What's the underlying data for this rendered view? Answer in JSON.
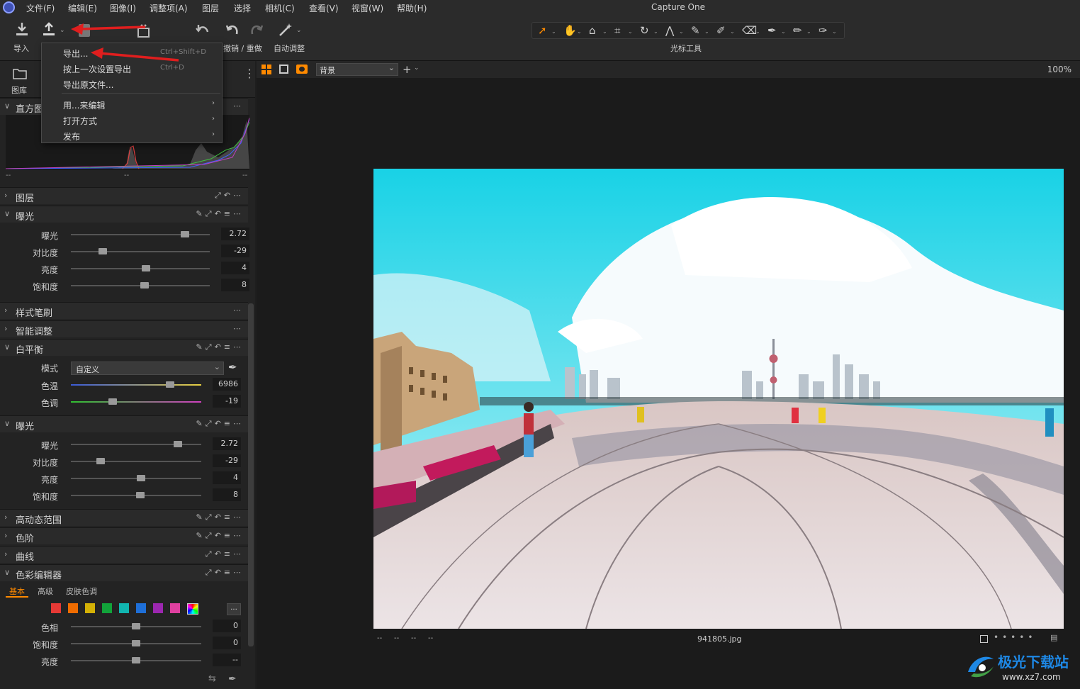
{
  "app": {
    "title": "Capture One"
  },
  "menubar": {
    "items": [
      "文件(F)",
      "编辑(E)",
      "图像(I)",
      "调整项(A)",
      "图层",
      "选择",
      "相机(C)",
      "查看(V)",
      "视窗(W)",
      "帮助(H)"
    ]
  },
  "toolbar": {
    "import_label": "导入",
    "undo_redo_label": "撤销 / 重做",
    "auto_adjust_label": "自动调整",
    "cursor_tools_label": "光标工具"
  },
  "export_menu": {
    "items": [
      {
        "label": "导出...",
        "shortcut": "Ctrl+Shift+D"
      },
      {
        "label": "按上一次设置导出",
        "shortcut": "Ctrl+D"
      },
      {
        "label": "导出原文件..."
      },
      {
        "label": "用...来编辑",
        "submenu": "›"
      },
      {
        "label": "打开方式",
        "submenu": "›"
      },
      {
        "label": "发布",
        "submenu": "›"
      }
    ]
  },
  "left_panel": {
    "tab_library": "图库",
    "histogram": {
      "title": "直方图",
      "footer": [
        "--",
        "--",
        "--"
      ]
    },
    "layers_title": "图层",
    "exposure1": {
      "title": "曝光",
      "rows": [
        {
          "label": "曝光",
          "value": "2.72",
          "level": 0.82
        },
        {
          "label": "对比度",
          "value": "-29",
          "level": 0.23
        },
        {
          "label": "亮度",
          "value": "4",
          "level": 0.54
        },
        {
          "label": "饱和度",
          "value": "8",
          "level": 0.53
        }
      ]
    },
    "style_brush_title": "样式笔刷",
    "smart_adjust_title": "智能调整",
    "white_balance": {
      "title": "白平衡",
      "mode_label": "模式",
      "mode_value": "自定义",
      "rows": [
        {
          "label": "色温",
          "value": "6986",
          "level": 0.76
        },
        {
          "label": "色调",
          "value": "-19",
          "level": 0.32
        }
      ]
    },
    "exposure2": {
      "title": "曝光",
      "rows": [
        {
          "label": "曝光",
          "value": "2.72",
          "level": 0.82
        },
        {
          "label": "对比度",
          "value": "-29",
          "level": 0.23
        },
        {
          "label": "亮度",
          "value": "4",
          "level": 0.54
        },
        {
          "label": "饱和度",
          "value": "8",
          "level": 0.53
        }
      ]
    },
    "hdr_title": "高动态范围",
    "levels_title": "色阶",
    "curves_title": "曲线",
    "color_editor": {
      "title": "色彩编辑器",
      "tabs": [
        "基本",
        "高级",
        "皮肤色调"
      ],
      "swatches": [
        "#e53935",
        "#ef6c00",
        "#d4b106",
        "#12a33a",
        "#11b5b0",
        "#1e6fd8",
        "#9c27b0",
        "#e040a0"
      ],
      "more_label": "...",
      "rows": [
        {
          "label": "色相",
          "value": "0",
          "level": 0.5
        },
        {
          "label": "饱和度",
          "value": "0",
          "level": 0.5
        },
        {
          "label": "亮度",
          "value": "--",
          "level": 0.5
        }
      ]
    }
  },
  "viewer": {
    "layer_select": "背景",
    "zoom": "100%",
    "filename": "941805.jpg",
    "meta": [
      "--",
      "--",
      "--",
      "--"
    ]
  },
  "watermark": {
    "text": "极光下载站",
    "url": "www.xz7.com"
  },
  "colors": {
    "accent": "#ff8a00",
    "annotation": "#e01e1e"
  }
}
